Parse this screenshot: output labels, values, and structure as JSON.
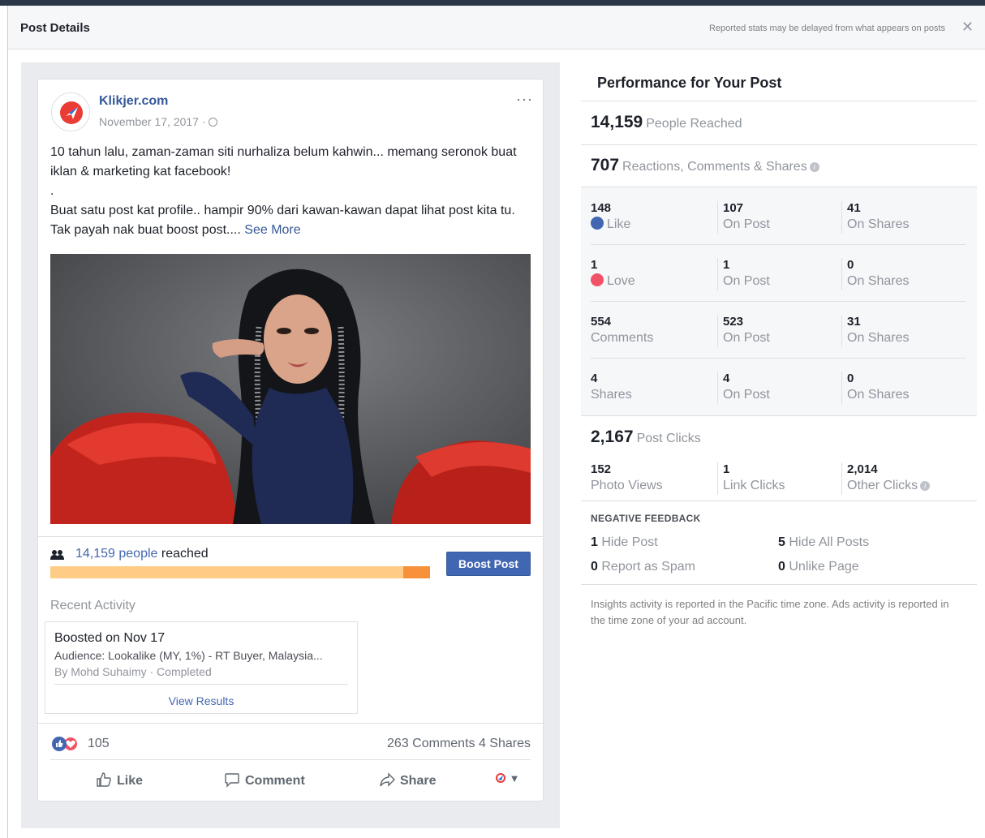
{
  "header": {
    "title": "Post Details",
    "note": "Reported stats may be delayed from what appears on posts",
    "close": "✕"
  },
  "post": {
    "page_name": "Klikjer.com",
    "date": "November 17, 2017 ·",
    "more": "···",
    "text_line1": "10 tahun lalu, zaman-zaman siti nurhaliza belum kahwin... memang seronok buat iklan & marketing kat facebook!",
    "text_dot": ".",
    "text_line2": "Buat satu post kat profile.. hampir 90% dari kawan-kawan dapat lihat post kita tu. Tak payah nak buat boost post....",
    "see_more": "See More",
    "reach_link": "14,159 people",
    "reach_suffix": " reached",
    "reach_bar_fraction": 0.93,
    "boost_label": "Boost Post",
    "recent_title": "Recent Activity",
    "activity": {
      "title": "Boosted on Nov 17",
      "audience": "Audience: Lookalike (MY, 1%) - RT Buyer, Malaysia...",
      "by": "By Mohd Suhaimy · Completed",
      "view": "View Results"
    },
    "reaction_count": "105",
    "comments_shares": "263 Comments  4 Shares",
    "actions": {
      "like": "Like",
      "comment": "Comment",
      "share": "Share"
    }
  },
  "insights": {
    "title": "Performance for Your Post",
    "reached_num": "14,159",
    "reached_label": "People Reached",
    "engage_num": "707",
    "engage_label": "Reactions, Comments & Shares",
    "rows": [
      {
        "total": "148",
        "label": "Like",
        "on_post": "107",
        "on_post_label": "On Post",
        "on_shares": "41",
        "on_shares_label": "On Shares"
      },
      {
        "total": "1",
        "label": "Love",
        "on_post": "1",
        "on_post_label": "On Post",
        "on_shares": "0",
        "on_shares_label": "On Shares"
      },
      {
        "total": "554",
        "label": "Comments",
        "on_post": "523",
        "on_post_label": "On Post",
        "on_shares": "31",
        "on_shares_label": "On Shares"
      },
      {
        "total": "4",
        "label": "Shares",
        "on_post": "4",
        "on_post_label": "On Post",
        "on_shares": "0",
        "on_shares_label": "On Shares"
      }
    ],
    "clicks_num": "2,167",
    "clicks_label": "Post Clicks",
    "clicks": [
      {
        "num": "152",
        "label": "Photo Views"
      },
      {
        "num": "1",
        "label": "Link Clicks"
      },
      {
        "num": "2,014",
        "label": "Other Clicks"
      }
    ],
    "neg_title": "NEGATIVE FEEDBACK",
    "neg": {
      "hide_post_num": "1",
      "hide_post": "Hide Post",
      "hide_all_num": "5",
      "hide_all": "Hide All Posts",
      "spam_num": "0",
      "spam": "Report as Spam",
      "unlike_num": "0",
      "unlike": "Unlike Page"
    },
    "footer": "Insights activity is reported in the Pacific time zone. Ads activity is reported in the time zone of your ad account."
  },
  "colors": {
    "link": "#365899",
    "boost": "#4267b2",
    "reach_bar": "#ffcc85",
    "reach_fill": "#f7923a",
    "love": "#f25268"
  }
}
